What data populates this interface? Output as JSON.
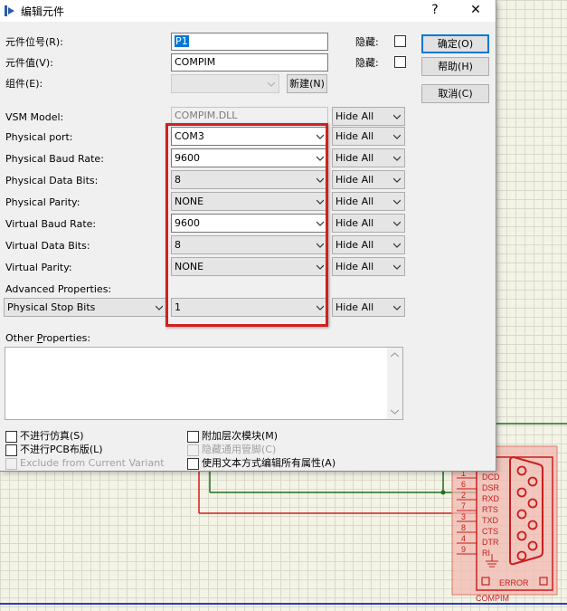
{
  "dialog": {
    "title": "编辑元件",
    "help_button": "?",
    "close_button": "✕"
  },
  "fields": {
    "ref_label": "元件位号(R):",
    "ref_value": "P1",
    "ref_hidden_label": "隐藏:",
    "value_label": "元件值(V):",
    "value_value": "COMPIM",
    "value_hidden_label": "隐藏:",
    "group_label": "组件(E):",
    "new_button": "新建(N)"
  },
  "buttons": {
    "ok": "确定(O)",
    "help": "帮助(H)",
    "cancel": "取消(C)"
  },
  "properties": [
    {
      "label": "VSM Model:",
      "value": "COMPIM.DLL",
      "visibility": "Hide All"
    },
    {
      "label": "Physical port:",
      "value": "COM3",
      "visibility": "Hide All"
    },
    {
      "label": "Physical Baud Rate:",
      "value": "9600",
      "visibility": "Hide All"
    },
    {
      "label": "Physical Data Bits:",
      "value": "8",
      "visibility": "Hide All"
    },
    {
      "label": "Physical Parity:",
      "value": "NONE",
      "visibility": "Hide All"
    },
    {
      "label": "Virtual Baud Rate:",
      "value": "9600",
      "visibility": "Hide All"
    },
    {
      "label": "Virtual Data Bits:",
      "value": "8",
      "visibility": "Hide All"
    },
    {
      "label": "Virtual Parity:",
      "value": "NONE",
      "visibility": "Hide All"
    }
  ],
  "advanced": {
    "label": "Advanced Properties:",
    "property": "Physical Stop Bits",
    "value": "1",
    "visibility": "Hide All"
  },
  "other": {
    "label_prefix": "Other ",
    "label_underlined": "P",
    "label_suffix": "roperties:"
  },
  "options": {
    "exclude_sim": "不进行仿真(S)",
    "exclude_pcb": "不进行PCB布版(L)",
    "exclude_variant": "Exclude from Current Variant",
    "attach_hierarchy": "附加层次模块(M)",
    "hide_common_pins": "隐藏通用管脚(C)",
    "edit_all_text": "使用文本方式编辑所有属性(A)"
  },
  "schematic": {
    "pins": [
      {
        "num": "1",
        "name": "DCD"
      },
      {
        "num": "6",
        "name": "DSR"
      },
      {
        "num": "2",
        "name": "RXD"
      },
      {
        "num": "7",
        "name": "RTS"
      },
      {
        "num": "3",
        "name": "TXD"
      },
      {
        "num": "8",
        "name": "CTS"
      },
      {
        "num": "4",
        "name": "DTR"
      },
      {
        "num": "9",
        "name": "RI"
      }
    ],
    "error_label": "ERROR",
    "component_label": "COMPIM"
  }
}
